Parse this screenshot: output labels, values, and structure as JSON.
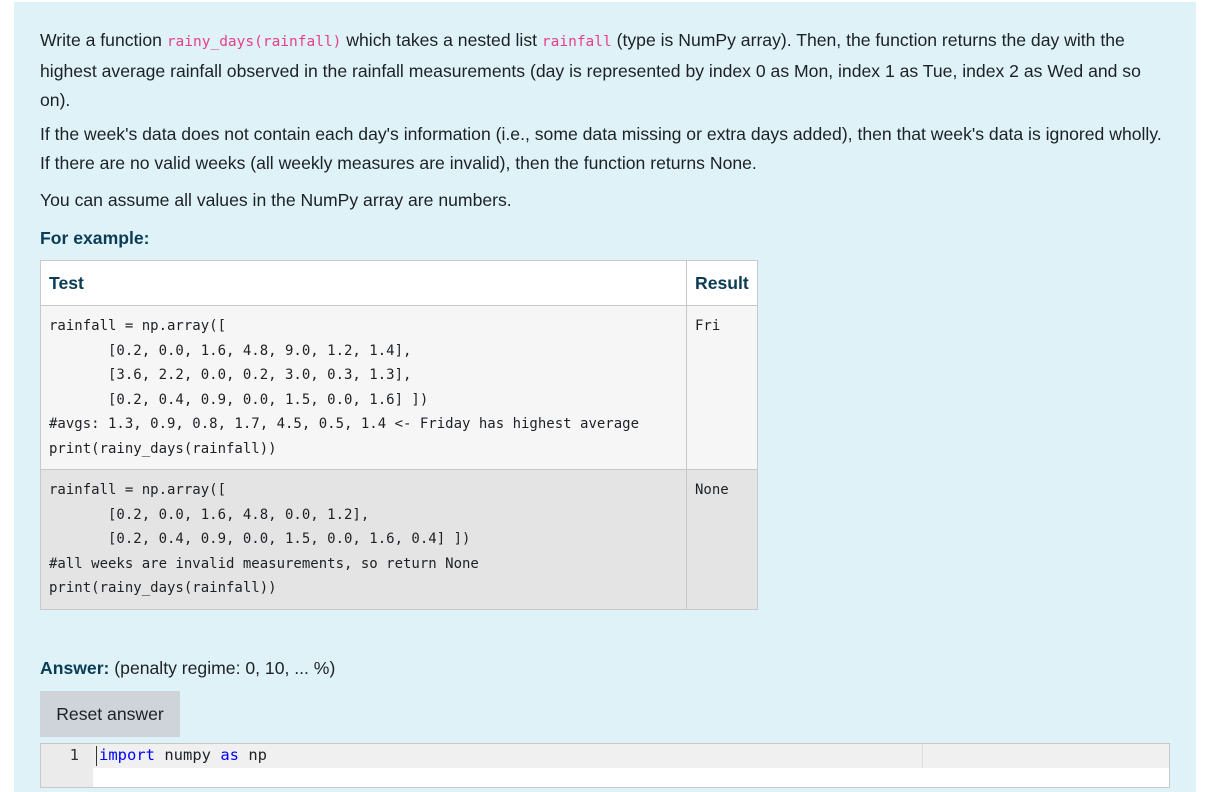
{
  "question": {
    "p1_before_fn": "Write a function ",
    "function_signature": "rainy_days(rainfall)",
    "p1_mid": " which takes a nested list ",
    "param_name": "rainfall",
    "p1_after": " (type is NumPy array). Then, the function returns the day with the highest average rainfall observed in the rainfall measurements (day is represented by index 0 as Mon, index 1 as Tue, index 2 as Wed and so on).",
    "p2": "If the week's data does not contain each day's information (i.e., some data missing or extra days added), then that week's data is ignored wholly. If there are no valid weeks (all weekly measures are invalid), then the function returns None.",
    "p3": "You can assume all values in the NumPy array are numbers.",
    "example_heading": "For example:"
  },
  "examples_table": {
    "headers": {
      "test": "Test",
      "result": "Result"
    },
    "rows": [
      {
        "test": "rainfall = np.array([\n       [0.2, 0.0, 1.6, 4.8, 9.0, 1.2, 1.4],\n       [3.6, 2.2, 0.0, 0.2, 3.0, 0.3, 1.3],\n       [0.2, 0.4, 0.9, 0.0, 1.5, 0.0, 1.6] ])\n#avgs: 1.3, 0.9, 0.8, 1.7, 4.5, 0.5, 1.4 <- Friday has highest average\nprint(rainy_days(rainfall))",
        "result": "Fri"
      },
      {
        "test": "rainfall = np.array([\n       [0.2, 0.0, 1.6, 4.8, 0.0, 1.2],\n       [0.2, 0.4, 0.9, 0.0, 1.5, 0.0, 1.6, 0.4] ])\n#all weeks are invalid measurements, so return None\nprint(rainy_days(rainfall))",
        "result": "None"
      }
    ]
  },
  "answer": {
    "label": "Answer:",
    "penalty": " (penalty regime: 0, 10, ... %)",
    "reset_label": "Reset answer"
  },
  "editor": {
    "line_number": "1",
    "keyword_import": "import",
    "module": " numpy ",
    "keyword_as": "as",
    "alias": " np"
  }
}
